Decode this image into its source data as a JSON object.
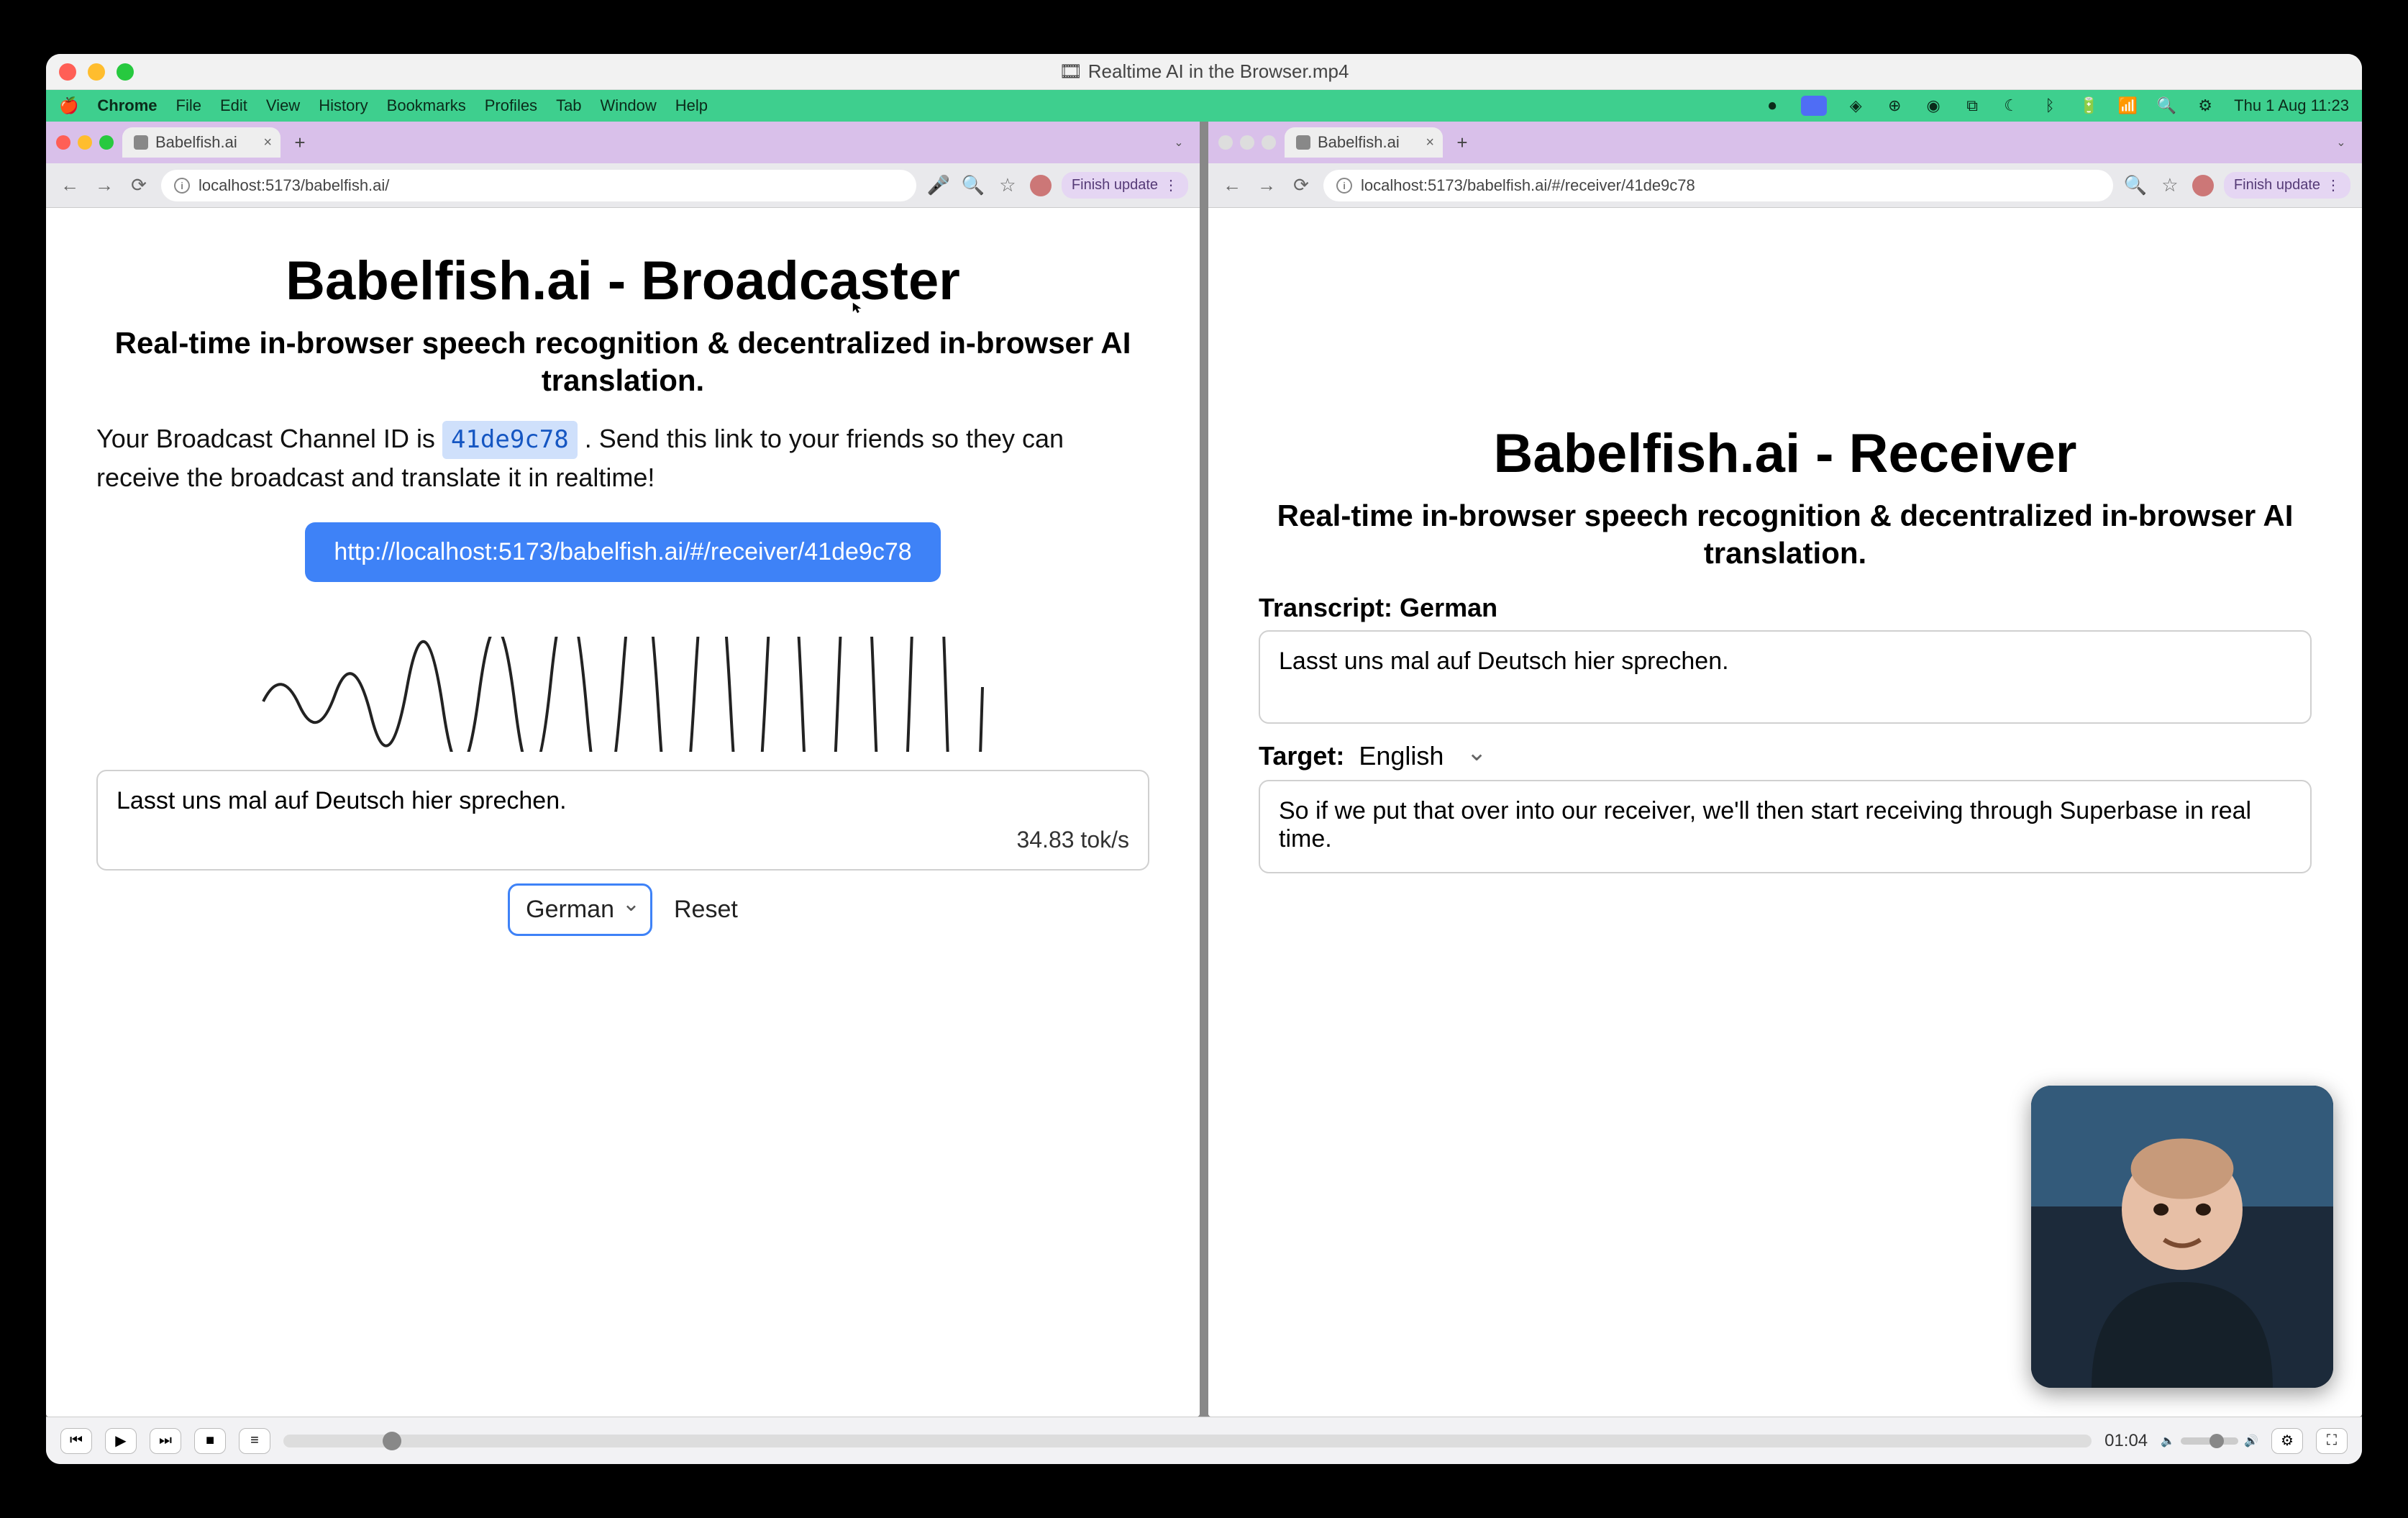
{
  "window": {
    "title": "Realtime AI in the Browser.mp4"
  },
  "menubar": {
    "app": "Chrome",
    "items": [
      "File",
      "Edit",
      "View",
      "History",
      "Bookmarks",
      "Profiles",
      "Tab",
      "Window",
      "Help"
    ],
    "clock": "Thu 1 Aug  11:23"
  },
  "browsers": {
    "left": {
      "tab_title": "Babelfish.ai",
      "url": "localhost:5173/babelfish.ai/",
      "finish_update": "Finish update",
      "page": {
        "title": "Babelfish.ai - Broadcaster",
        "subtitle": "Real-time in-browser speech recognition & decentralized in-browser AI translation.",
        "desc_pre": "Your Broadcast Channel ID is ",
        "channel_id": "41de9c78",
        "desc_post": " . Send this link to your friends so they can receive the broadcast and translate it in realtime!",
        "link": "http://localhost:5173/babelfish.ai/#/receiver/41de9c78",
        "transcript": "Lasst uns mal auf Deutsch hier sprechen.",
        "rate": "34.83 tok/s",
        "language": "German",
        "reset": "Reset"
      }
    },
    "right": {
      "tab_title": "Babelfish.ai",
      "url": "localhost:5173/babelfish.ai/#/receiver/41de9c78",
      "finish_update": "Finish update",
      "page": {
        "title": "Babelfish.ai - Receiver",
        "subtitle": "Real-time in-browser speech recognition & decentralized in-browser AI translation.",
        "transcript_label": "Transcript: German",
        "transcript": "Lasst uns mal auf Deutsch hier sprechen.",
        "target_label": "Target:",
        "target_lang": "English",
        "translation": "So if we put that over into our receiver, we'll then start receiving through Superbase in real time."
      }
    }
  },
  "player": {
    "time": "01:04"
  }
}
